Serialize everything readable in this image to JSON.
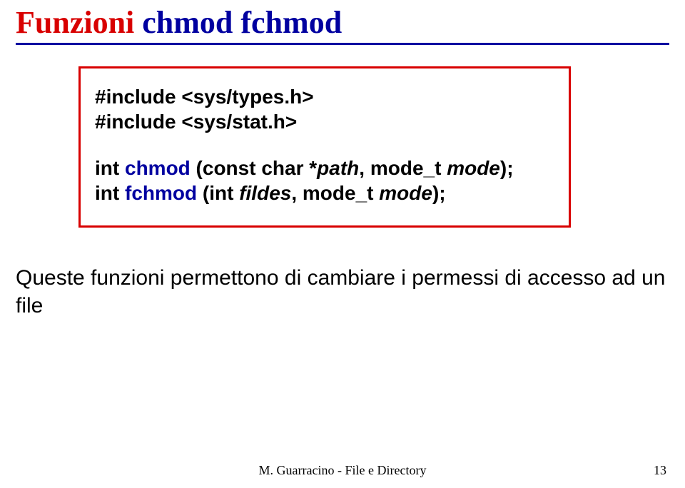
{
  "title": {
    "red": "Funzioni",
    "blue": " chmod fchmod"
  },
  "code": {
    "include1": "#include <sys/types.h>",
    "include2": "#include <sys/stat.h>",
    "sig1_pre": "int ",
    "sig1_fn": "chmod",
    "sig1_mid": " (const char *",
    "sig1_arg1": "path",
    "sig1_mid2": ", mode_t ",
    "sig1_arg2": "mode",
    "sig1_end": ");",
    "sig2_pre": "int ",
    "sig2_fn": "fchmod",
    "sig2_mid": " (int ",
    "sig2_arg1": "fildes",
    "sig2_mid2": ", mode_t ",
    "sig2_arg2": "mode",
    "sig2_end": ");"
  },
  "body": "Queste funzioni permettono di cambiare i permessi di accesso ad un file",
  "footer": "M. Guarracino - File e Directory",
  "page": "13"
}
